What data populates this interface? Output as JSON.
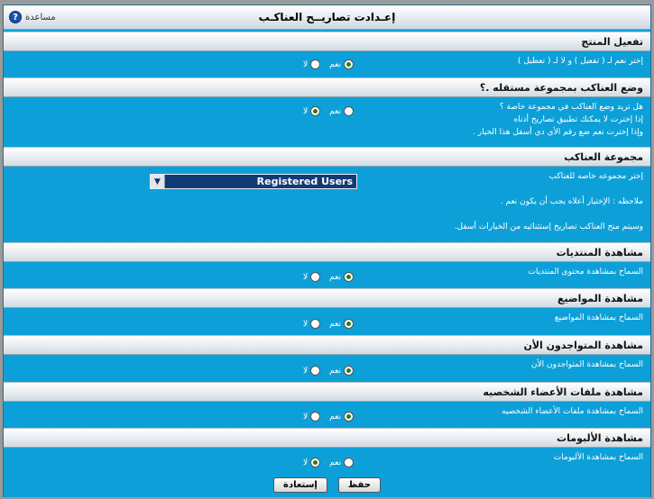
{
  "header": {
    "title": "إعـدادت تصاريــح العناكـب",
    "help_label": "مساعدة"
  },
  "sections": {
    "enable": {
      "title": "تفعيل المنتج",
      "desc": "إختر نعم لـ ( تفعيل ) و لا لـ ( تعطيل )",
      "yes": "نعم",
      "no": "لا",
      "selected": "yes"
    },
    "group_status": {
      "title": "وضع العناكب بمجموعة مستقله .؟",
      "desc1": "هل تريد وضع العناكب في مجموعة خاصة ؟",
      "desc2": "إذا إخترت لا يمكنك تطبيق تصاريح أدناه",
      "desc3": "وإذا إخترت نعم ضع رقم الأي دي أسفل هذا الخيار .",
      "yes": "نعم",
      "no": "لا",
      "selected": "no"
    },
    "group": {
      "title": "مجموعة العناكب",
      "desc1": "إختر مجموعه خاصه للعناكب",
      "desc2": "ملاحظه : الإختيار أعلاه يجب أن يكون نعم .",
      "desc3": "وسيتم منح العناكب تصاريح إستثنائيه من الخيارات أسفل.",
      "select_value": "Registered Users"
    },
    "forums": {
      "title": "مشاهدة المنتديات",
      "desc": "السماح بمشاهدة محتوى المنتديات",
      "yes": "نعم",
      "no": "لا",
      "selected": "yes"
    },
    "topics": {
      "title": "مشاهدة المواضيع",
      "desc": "السماح بمشاهدة المواضيع",
      "yes": "نعم",
      "no": "لا",
      "selected": "yes"
    },
    "online": {
      "title": "مشاهدة المتواجدون الأن",
      "desc": "السماح بمشاهدة المتواجدون الأن",
      "yes": "نعم",
      "no": "لا",
      "selected": "yes"
    },
    "profiles": {
      "title": "مشاهدة ملفات الأعضاء الشخصيه",
      "desc": "السماح بمشاهدة ملفات الأعضاء الشخصيه",
      "yes": "نعم",
      "no": "لا",
      "selected": "yes"
    },
    "albums": {
      "title": "مشاهدة الألبومات",
      "desc": "السماح بمشاهدة الألبومات",
      "yes": "نعم",
      "no": "لا",
      "selected": "no"
    }
  },
  "footer": {
    "save_label": "حفظ",
    "reset_label": "إستعادة"
  }
}
